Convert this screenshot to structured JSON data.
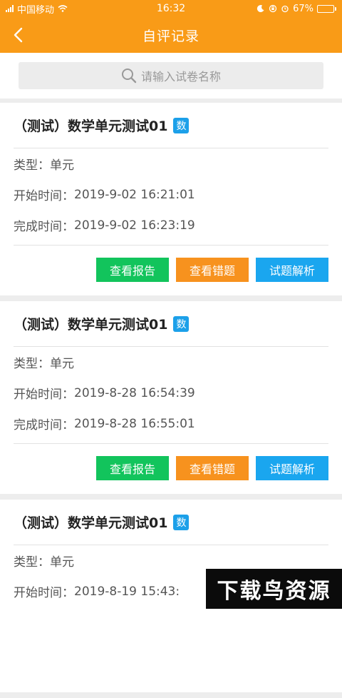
{
  "status_bar": {
    "carrier": "中国移动",
    "time": "16:32",
    "battery": "67%",
    "battery_level": 0.67
  },
  "nav": {
    "title": "自评记录"
  },
  "search": {
    "placeholder": "请输入试卷名称"
  },
  "records": [
    {
      "title": "（测试）数学单元测试01",
      "subject_badge": "数",
      "type_label": "类型：",
      "type_value": "单元",
      "start_label": "开始时间：",
      "start_value": "2019-9-02 16:21:01",
      "finish_label": "完成时间：",
      "finish_value": "2019-9-02 16:23:19",
      "btn_report": "查看报告",
      "btn_errors": "查看错题",
      "btn_analysis": "试题解析"
    },
    {
      "title": "（测试）数学单元测试01",
      "subject_badge": "数",
      "type_label": "类型：",
      "type_value": "单元",
      "start_label": "开始时间：",
      "start_value": "2019-8-28 16:54:39",
      "finish_label": "完成时间：",
      "finish_value": "2019-8-28 16:55:01",
      "btn_report": "查看报告",
      "btn_errors": "查看错题",
      "btn_analysis": "试题解析"
    },
    {
      "title": "（测试）数学单元测试01",
      "subject_badge": "数",
      "type_label": "类型：",
      "type_value": "单元",
      "start_label": "开始时间：",
      "start_value": "2019-8-19 15:43:"
    }
  ],
  "watermark": "下载鸟资源",
  "colors": {
    "accent": "#f99b17",
    "report_button": "#12c45c",
    "errors_button": "#f7921e",
    "analysis_button": "#1aa6ef",
    "subject_badge": "#1ca0e9"
  }
}
